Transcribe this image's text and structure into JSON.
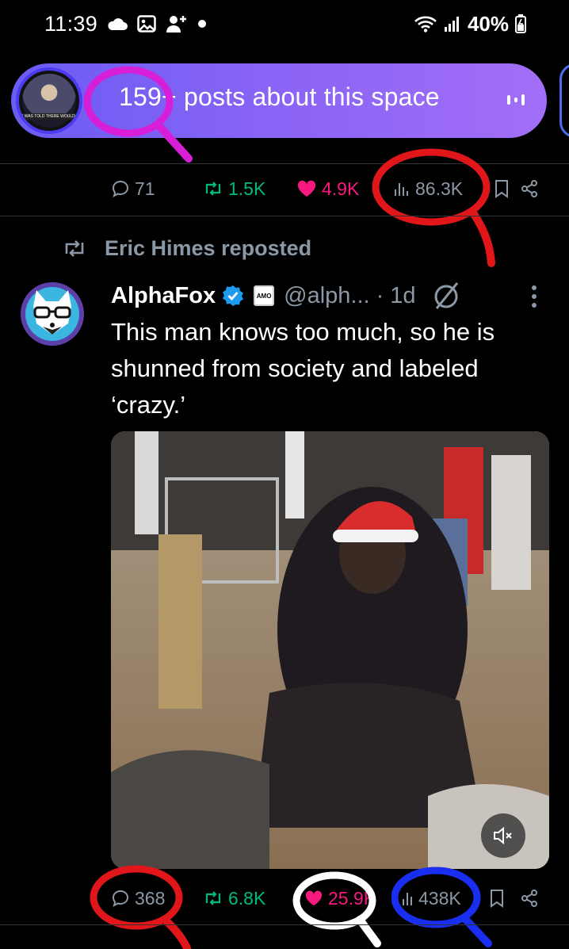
{
  "status_bar": {
    "time": "11:39",
    "battery": "40%",
    "icons": [
      "cloud-icon",
      "gallery-icon",
      "add-user-icon",
      "dot-icon",
      "wifi-icon",
      "signal-icon",
      "battery-icon"
    ]
  },
  "space": {
    "text": "159+ posts about this space",
    "avatar_caption": "I WAS TOLD THERE WOULD BE PEACE",
    "gradient_colors": [
      "#6b5cf3",
      "#a26ef7"
    ]
  },
  "top_actions": {
    "replies": "71",
    "reposts": "1.5K",
    "likes": "4.9K",
    "views": "86.3K"
  },
  "repost_header": {
    "text": "Eric Himes reposted"
  },
  "tweet": {
    "name": "AlphaFox",
    "badge": "AMO",
    "handle": "@alph...",
    "time": "· 1d",
    "text": "This man knows too much, so he is shunned from society and labeled ‘crazy.’",
    "media_icon": "mute-icon"
  },
  "bottom_actions": {
    "replies": "368",
    "reposts": "6.8K",
    "likes": "25.9K",
    "views": "438K"
  },
  "colors": {
    "reply_gray": "#8b98a5",
    "repost_green": "#00ba7c",
    "like_pink": "#f91880",
    "verified_blue": "#1d9bf0",
    "annotation_red": "#e0161b",
    "annotation_magenta": "#d61fd6",
    "annotation_blue": "#1a2ef2",
    "annotation_white": "#ffffff"
  }
}
